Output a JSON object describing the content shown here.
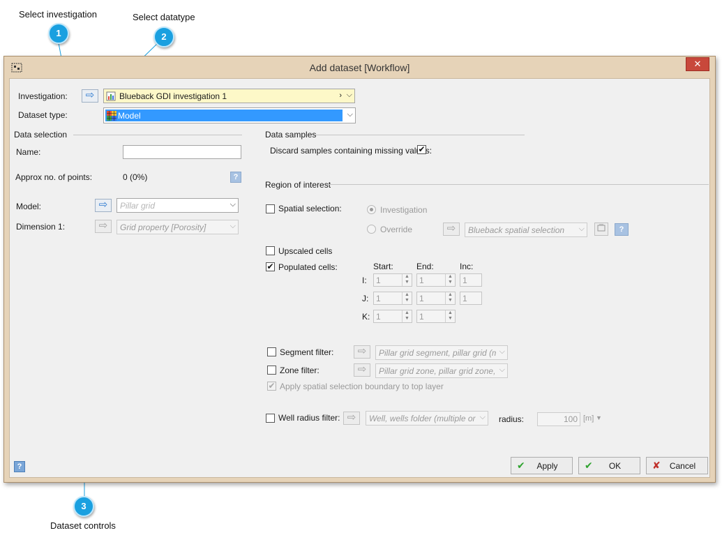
{
  "callouts": [
    {
      "number": "1",
      "label": "Select investigation"
    },
    {
      "number": "2",
      "label": "Select datatype"
    },
    {
      "number": "3",
      "label": "Dataset controls"
    }
  ],
  "window": {
    "title": "Add dataset  [Workflow]",
    "close_glyph": "✕"
  },
  "header": {
    "investigation_label": "Investigation:",
    "investigation_value": "Blueback GDI investigation 1",
    "investigation_suffix": "›",
    "dataset_type_label": "Dataset type:",
    "dataset_type_value": "Model"
  },
  "data_selection": {
    "section": "Data selection",
    "name_label": "Name:",
    "name_value": "",
    "approx_label": "Approx no. of points:",
    "approx_value": "0 (0%)",
    "model_label": "Model:",
    "model_placeholder": "Pillar grid",
    "dimension_label": "Dimension 1:",
    "dimension_value": "Grid property [Porosity]"
  },
  "data_samples": {
    "section": "Data samples",
    "discard_label": "Discard samples containing missing values:",
    "discard_checked": true
  },
  "roi": {
    "section": "Region of interest",
    "spatial_label": "Spatial selection:",
    "radio_investigation": "Investigation",
    "radio_override": "Override",
    "spatial_combo": "Blueback spatial selection",
    "upscaled_label": "Upscaled cells",
    "populated_label": "Populated cells:",
    "col_start": "Start:",
    "col_end": "End:",
    "col_inc": "Inc:",
    "rows": [
      {
        "axis": "I:",
        "start": "1",
        "end": "1",
        "inc": "1"
      },
      {
        "axis": "J:",
        "start": "1",
        "end": "1",
        "inc": "1"
      },
      {
        "axis": "K:",
        "start": "1",
        "end": "1"
      }
    ],
    "segment_label": "Segment filter:",
    "segment_combo": "Pillar grid segment, pillar grid (multipl",
    "zone_label": "Zone filter:",
    "zone_combo": "Pillar grid zone, pillar grid zone, pillar",
    "apply_boundary_label": "Apply spatial selection boundary to top layer",
    "well_label": "Well radius filter:",
    "well_combo": "Well, wells folder (multiple or fold",
    "radius_label": "radius:",
    "radius_value": "100",
    "radius_unit": "[m]"
  },
  "buttons": {
    "apply": "Apply",
    "ok": "OK",
    "cancel": "Cancel"
  },
  "icons": {
    "arrow": "⇨",
    "chevron": "⌵",
    "check": "✔",
    "cancel_x": "✘",
    "help": "?"
  },
  "colors": {
    "frame": "#e6d3b8",
    "client": "#f0f0f0",
    "selection": "#3399ff",
    "investigation_field": "#fdf8c8",
    "callout": "#1aa0e0",
    "close": "#c8483b"
  }
}
